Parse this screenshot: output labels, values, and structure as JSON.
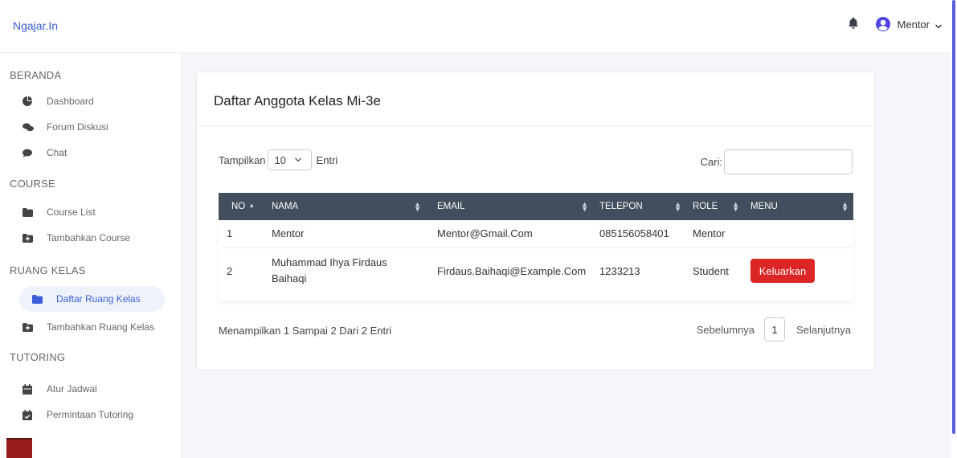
{
  "brand": "Ngajar.In",
  "user": {
    "name": "Mentor"
  },
  "colors": {
    "accent": "#3b5ed6",
    "header_bg": "#424d5e",
    "danger": "#dc2626",
    "active_bg": "#eef2fb"
  },
  "sidebar": {
    "sections": [
      {
        "title": "BERANDA",
        "items": [
          {
            "label": "Dashboard",
            "icon": "dashboard-icon"
          },
          {
            "label": "Forum Diskusi",
            "icon": "comments-icon"
          },
          {
            "label": "Chat",
            "icon": "chat-icon"
          }
        ]
      },
      {
        "title": "COURSE",
        "items": [
          {
            "label": "Course List",
            "icon": "folder-icon"
          },
          {
            "label": "Tambahkan Course",
            "icon": "folder-plus-icon"
          }
        ]
      },
      {
        "title": "RUANG KELAS",
        "items": [
          {
            "label": "Daftar Ruang Kelas",
            "icon": "folder-icon",
            "active": true
          },
          {
            "label": "Tambahkan Ruang Kelas",
            "icon": "folder-plus-icon"
          }
        ]
      },
      {
        "title": "TUTORING",
        "items": [
          {
            "label": "Atur Jadwal",
            "icon": "calendar-icon"
          },
          {
            "label": "Permintaan Tutoring",
            "icon": "calendar-check-icon"
          }
        ]
      }
    ]
  },
  "card": {
    "title": "Daftar Anggota Kelas Mi-3e",
    "length_prefix": "Tampilkan",
    "length_value": "10",
    "length_suffix": "Entri",
    "search_label": "Cari:",
    "search_value": ""
  },
  "table": {
    "headers": [
      "NO",
      "NAMA",
      "EMAIL",
      "TELEPON",
      "ROLE",
      "MENU"
    ],
    "rows": [
      {
        "no": "1",
        "nama": "Mentor",
        "email": "Mentor@Gmail.Com",
        "telepon": "085156058401",
        "role": "Mentor",
        "menu": ""
      },
      {
        "no": "2",
        "nama": "Muhammad Ihya Firdaus Baihaqi",
        "email": "Firdaus.Baihaqi@Example.Com",
        "telepon": "1233213",
        "role": "Student",
        "menu": "Keluarkan"
      }
    ]
  },
  "footer": {
    "info": "Menampilkan 1 Sampai 2 Dari 2 Entri",
    "prev": "Sebelumnya",
    "page": "1",
    "next": "Selanjutnya"
  }
}
